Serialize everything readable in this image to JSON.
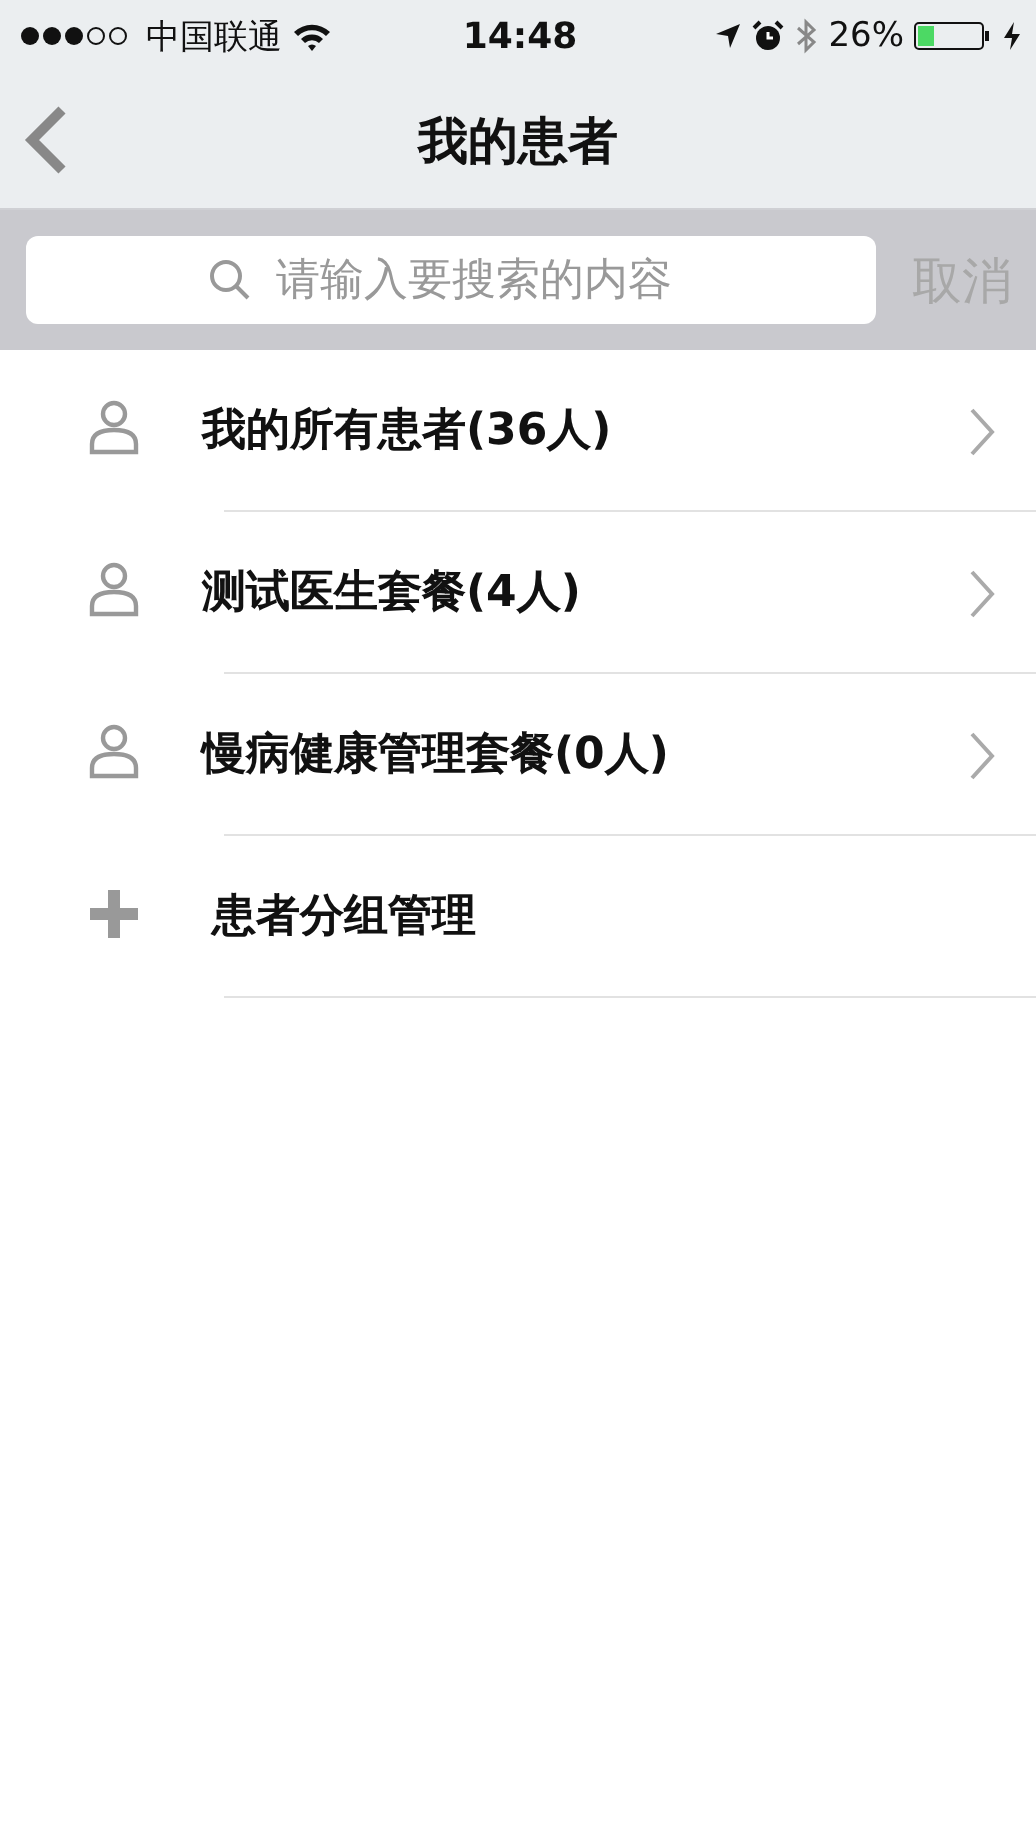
{
  "status_bar": {
    "carrier": "中国联通",
    "time": "14:48",
    "battery": "26%"
  },
  "nav": {
    "title": "我的患者"
  },
  "search": {
    "placeholder": "请输入要搜索的内容",
    "cancel": "取消"
  },
  "items": [
    {
      "kind": "group",
      "label": "我的所有患者(36人)"
    },
    {
      "kind": "group",
      "label": "测试医生套餐(4人)"
    },
    {
      "kind": "group",
      "label": "慢病健康管理套餐(0人)"
    },
    {
      "kind": "action",
      "label": "患者分组管理"
    }
  ]
}
